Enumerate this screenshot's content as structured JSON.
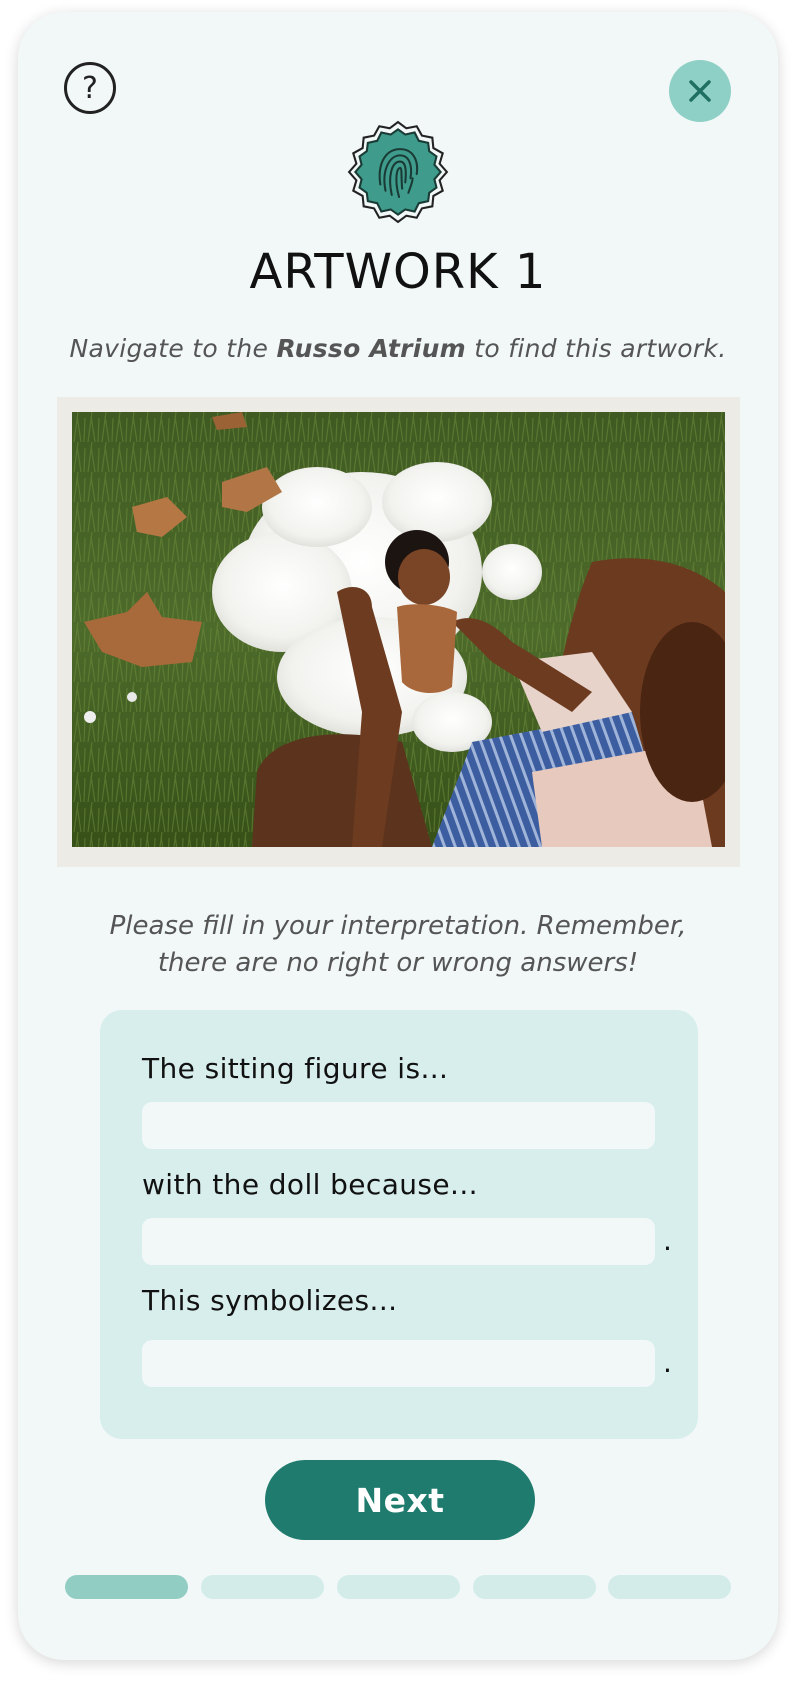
{
  "header": {
    "help_icon": "question-circle-icon",
    "close_icon": "close-x-icon",
    "badge_icon": "fingerprint-badge-icon",
    "title": "ARTWORK 1"
  },
  "navigation": {
    "prefix": "Navigate to the ",
    "location": "Russo Atrium",
    "suffix": " to find this artwork."
  },
  "artwork": {
    "description": "Photograph of a woman sitting on grass holding a doll surrounded by cotton stuffing"
  },
  "instructions": "Please fill in your interpretation. Remember, there are no right or wrong answers!",
  "form": {
    "prompts": [
      "The sitting figure is...",
      "with the doll because...",
      "This symbolizes..."
    ],
    "values": [
      "",
      "",
      ""
    ],
    "period": "."
  },
  "next_label": "Next",
  "progress": {
    "total_steps": 5,
    "current_step": 1
  },
  "colors": {
    "accent": "#1f7b6d",
    "close_bg": "#8fd0c6",
    "form_bg": "#d7eeed",
    "progress_active": "#92cdc3",
    "progress_inactive": "#d3ecea",
    "card_bg": "#f1f8f7"
  }
}
